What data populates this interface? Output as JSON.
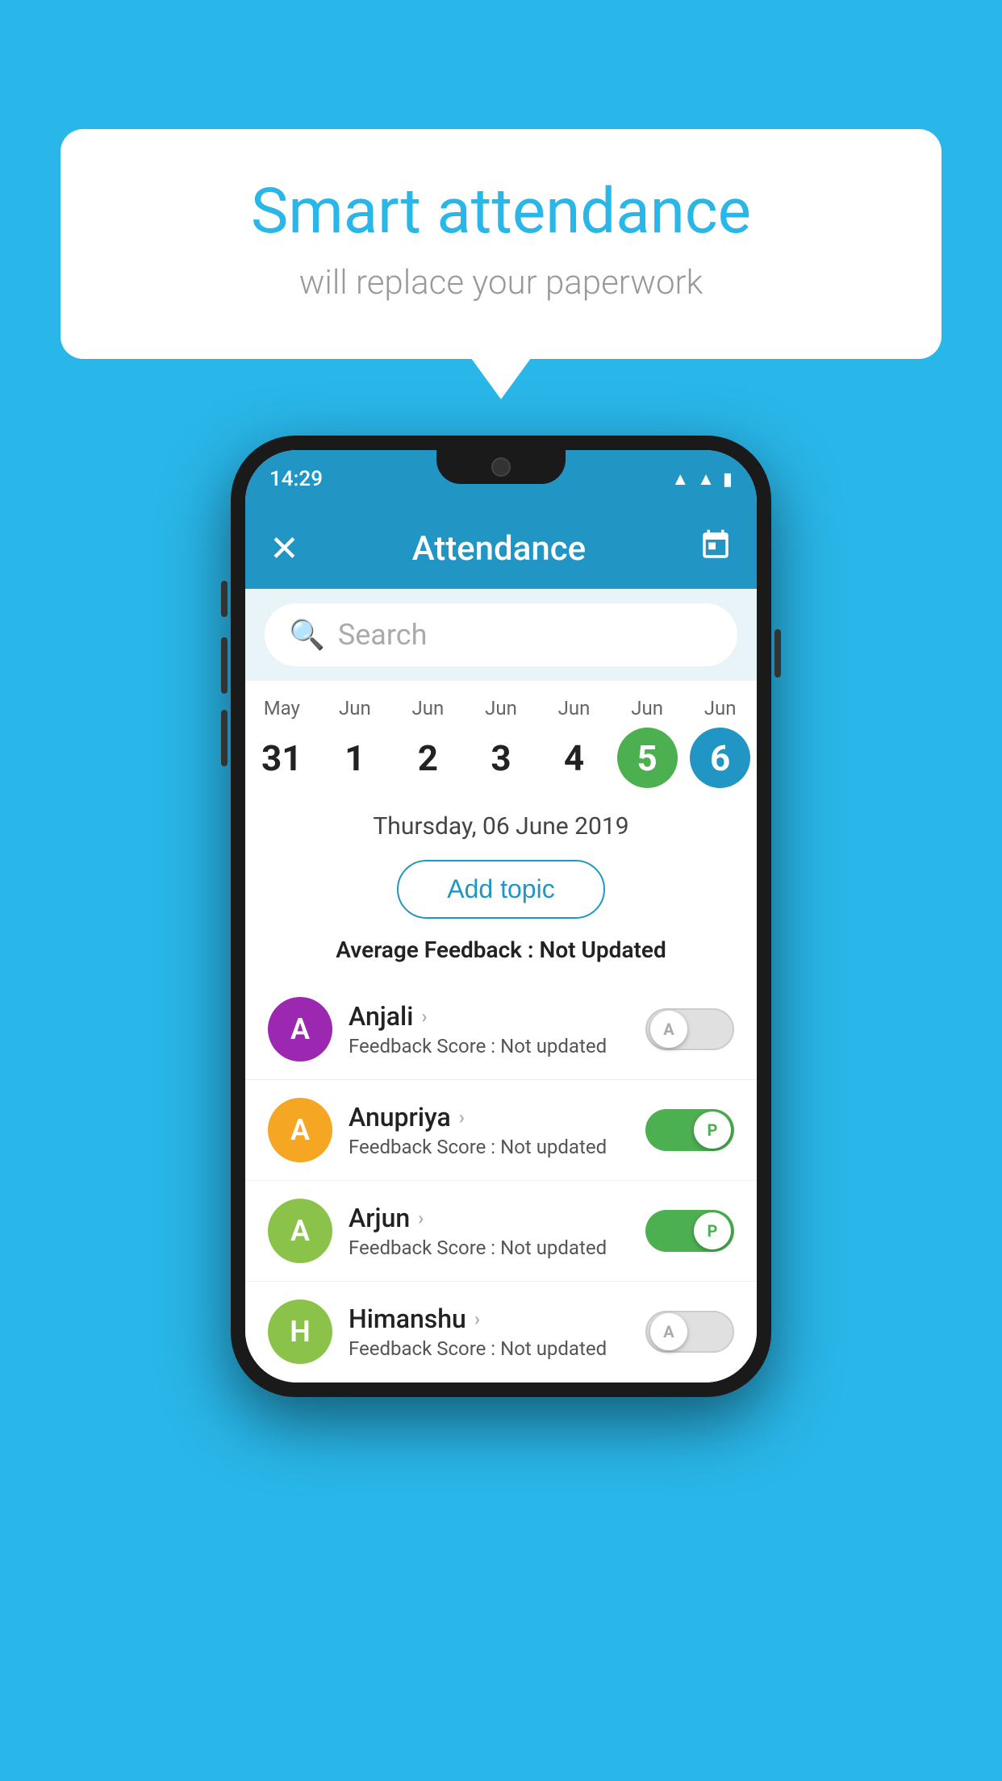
{
  "background_color": "#29b6e8",
  "speech_bubble": {
    "title": "Smart attendance",
    "subtitle": "will replace your paperwork"
  },
  "status_bar": {
    "time": "14:29",
    "wifi": "▲",
    "signal": "▲",
    "battery": "▮"
  },
  "app_header": {
    "title": "Attendance",
    "close_label": "✕",
    "calendar_icon": "📅"
  },
  "search": {
    "placeholder": "Search"
  },
  "calendar": {
    "days": [
      {
        "month": "May",
        "number": "31",
        "state": "normal"
      },
      {
        "month": "Jun",
        "number": "1",
        "state": "normal"
      },
      {
        "month": "Jun",
        "number": "2",
        "state": "normal"
      },
      {
        "month": "Jun",
        "number": "3",
        "state": "normal"
      },
      {
        "month": "Jun",
        "number": "4",
        "state": "normal"
      },
      {
        "month": "Jun",
        "number": "5",
        "state": "today"
      },
      {
        "month": "Jun",
        "number": "6",
        "state": "selected"
      }
    ]
  },
  "selected_date": "Thursday, 06 June 2019",
  "add_topic_label": "Add topic",
  "average_feedback": {
    "label": "Average Feedback : ",
    "value": "Not Updated"
  },
  "students": [
    {
      "name": "Anjali",
      "avatar_letter": "A",
      "avatar_color": "#9c27b0",
      "feedback_label": "Feedback Score : ",
      "feedback_value": "Not updated",
      "toggle_state": "off",
      "toggle_label": "A"
    },
    {
      "name": "Anupriya",
      "avatar_letter": "A",
      "avatar_color": "#f5a623",
      "feedback_label": "Feedback Score : ",
      "feedback_value": "Not updated",
      "toggle_state": "on",
      "toggle_label": "P"
    },
    {
      "name": "Arjun",
      "avatar_letter": "A",
      "avatar_color": "#8bc34a",
      "feedback_label": "Feedback Score : ",
      "feedback_value": "Not updated",
      "toggle_state": "on",
      "toggle_label": "P"
    },
    {
      "name": "Himanshu",
      "avatar_letter": "H",
      "avatar_color": "#8bc34a",
      "feedback_label": "Feedback Score : ",
      "feedback_value": "Not updated",
      "toggle_state": "off",
      "toggle_label": "A"
    }
  ]
}
